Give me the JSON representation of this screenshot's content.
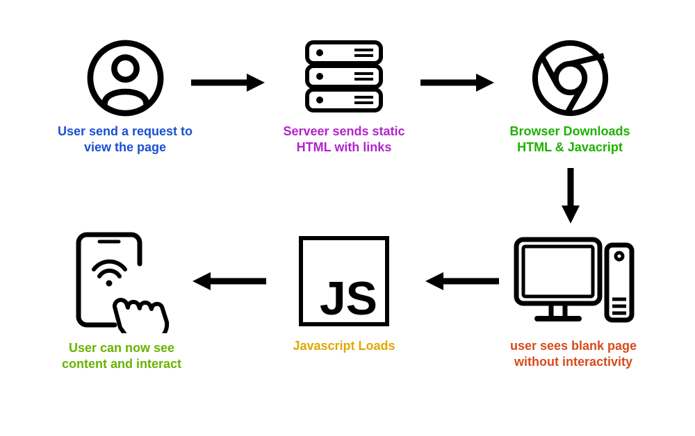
{
  "diagram": {
    "nodes": {
      "user_request": {
        "label": "User send a request to\nview the page",
        "color": "#1a4fd6"
      },
      "server": {
        "label": "Serveer sends static\nHTML with links",
        "color": "#b224c9"
      },
      "browser": {
        "label": "Browser  Downloads\nHTML & Javacript",
        "color": "#1db100"
      },
      "blank_page": {
        "label": "user sees blank page\nwithout interactivity",
        "color": "#d84a1b"
      },
      "js_loads": {
        "label": "Javascript Loads",
        "color": "#e0a800"
      },
      "user_interacts": {
        "label": "User can now see\ncontent and interact",
        "color": "#67b300"
      }
    },
    "flow_order": [
      "user_request",
      "server",
      "browser",
      "blank_page",
      "js_loads",
      "user_interacts"
    ]
  }
}
